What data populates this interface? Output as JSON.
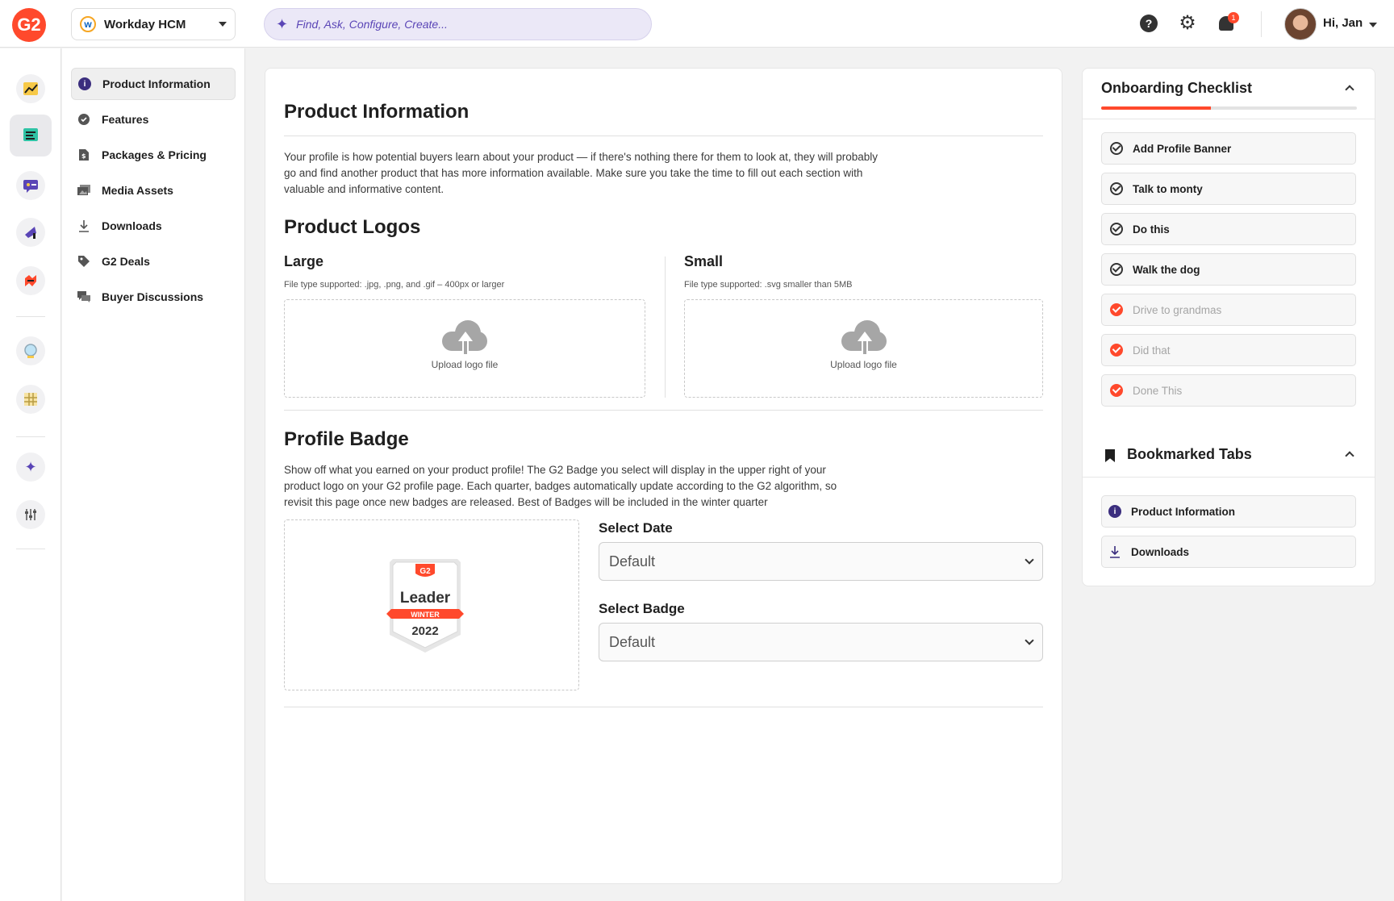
{
  "header": {
    "logo_text": "G2",
    "product_select": {
      "logo_text": "w",
      "value": "Workday HCM"
    },
    "search": {
      "placeholder": "Find, Ask, Configure, Create..."
    },
    "notifications_count": "1",
    "greeting": "Hi, Jan"
  },
  "rail": {
    "items": [
      {
        "icon": "chart-icon"
      },
      {
        "icon": "profile-editor-icon",
        "active": true
      },
      {
        "icon": "reviews-icon"
      },
      {
        "icon": "marketing-icon"
      },
      {
        "icon": "integrations-icon"
      },
      {
        "icon": "insights-icon"
      },
      {
        "icon": "grid-icon"
      },
      {
        "icon": "ai-sparkle-icon"
      },
      {
        "icon": "settings-sliders-icon"
      }
    ]
  },
  "subnav": {
    "items": [
      {
        "label": "Product Information",
        "icon": "info-icon",
        "active": true
      },
      {
        "label": "Features",
        "icon": "badge-check-icon"
      },
      {
        "label": "Packages & Pricing",
        "icon": "price-tag-doc-icon"
      },
      {
        "label": "Media Assets",
        "icon": "images-icon"
      },
      {
        "label": "Downloads",
        "icon": "download-icon"
      },
      {
        "label": "G2 Deals",
        "icon": "tag-icon"
      },
      {
        "label": "Buyer Discussions",
        "icon": "chat-icon"
      }
    ]
  },
  "main": {
    "title": "Product Information",
    "intro": "Your profile is how potential buyers learn about your product — if there's nothing there for them to look at, they will probably go and find another product that has more information available. Make sure you take the time to fill out each section with valuable and informative content.",
    "logos": {
      "title": "Product Logos",
      "large": {
        "title": "Large",
        "hint": "File type supported: .jpg, .png, and .gif – 400px or larger",
        "upload_label": "Upload logo file"
      },
      "small": {
        "title": "Small",
        "hint": "File type supported: .svg smaller than 5MB",
        "upload_label": "Upload logo file"
      }
    },
    "badge": {
      "title": "Profile Badge",
      "description": "Show off what you earned on your product profile! The G2 Badge you select will display in the upper right of your product logo on your G2 profile page.  Each quarter, badges automatically update according to the G2 algorithm, so revisit this page once new badges are released. Best of Badges will be included in the winter quarter",
      "preview": {
        "logo": "G2",
        "title": "Leader",
        "season": "WINTER",
        "year": "2022"
      },
      "date_label": "Select Date",
      "date_value": "Default",
      "badge_label": "Select Badge",
      "badge_value": "Default"
    }
  },
  "checklist": {
    "title": "Onboarding Checklist",
    "progress": 0.43,
    "items": [
      {
        "label": "Add Profile Banner",
        "done": false
      },
      {
        "label": "Talk to monty",
        "done": false
      },
      {
        "label": "Do this",
        "done": false
      },
      {
        "label": "Walk the dog",
        "done": false
      },
      {
        "label": "Drive to grandmas",
        "done": true
      },
      {
        "label": "Did that",
        "done": true
      },
      {
        "label": "Done This",
        "done": true
      }
    ]
  },
  "bookmarks": {
    "title": "Bookmarked Tabs",
    "items": [
      {
        "label": "Product Information",
        "icon": "info-icon"
      },
      {
        "label": "Downloads",
        "icon": "download-icon"
      }
    ]
  },
  "colors": {
    "brand": "#ff492c",
    "accent": "#5a45b6",
    "info": "#3b2e7e"
  }
}
